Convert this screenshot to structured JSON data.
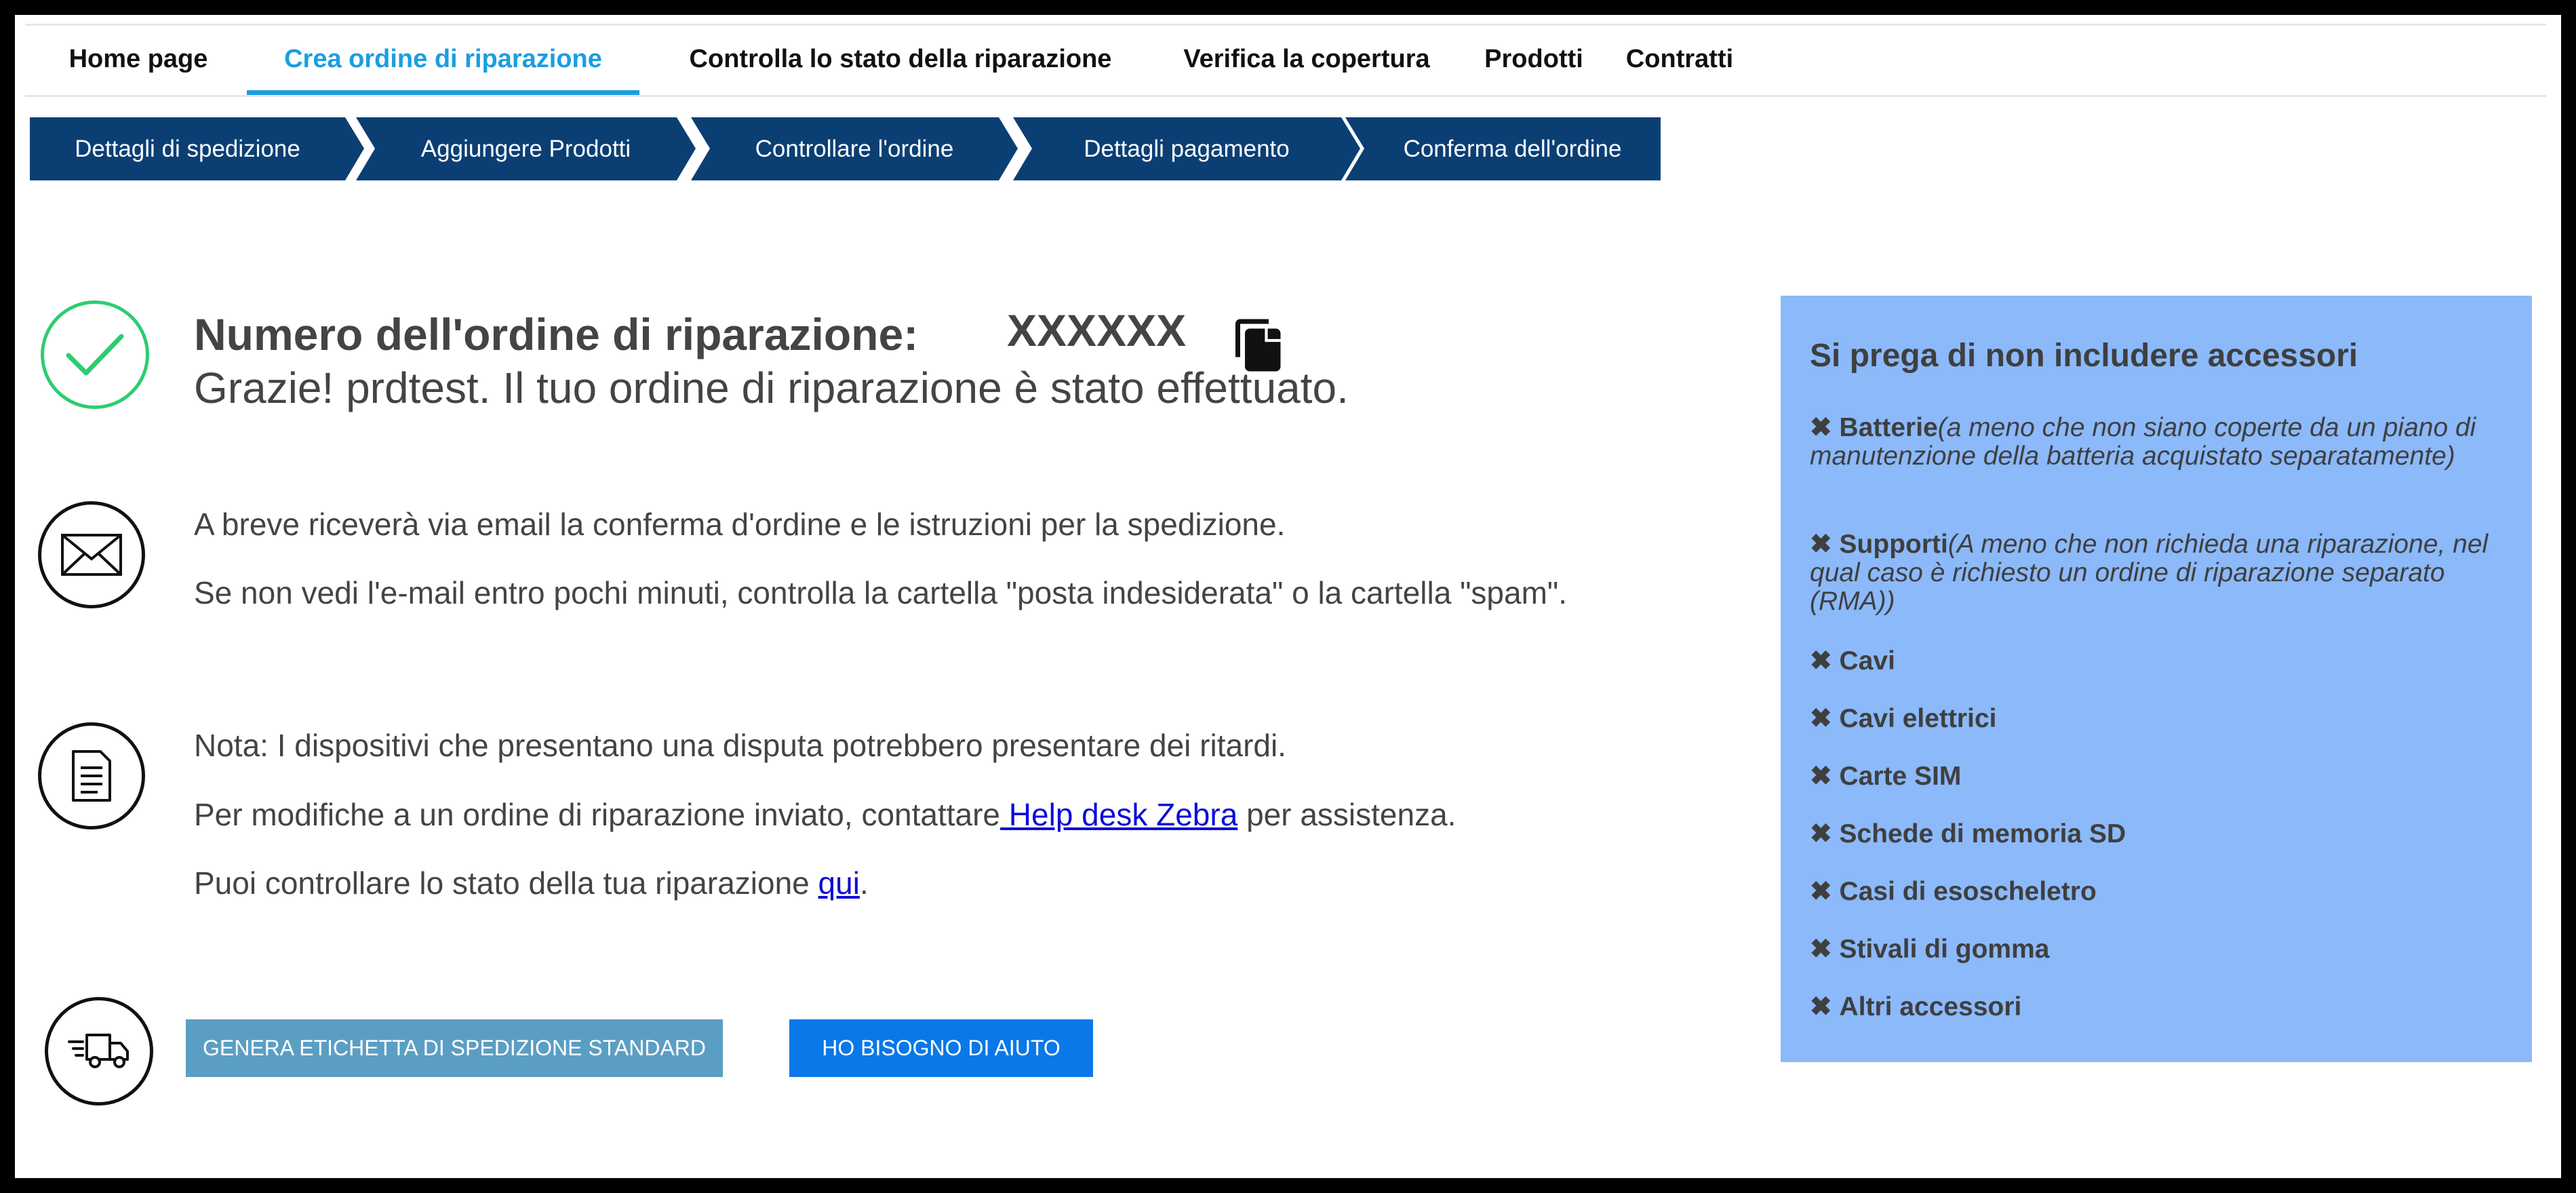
{
  "nav": {
    "tabs": [
      {
        "label": "Home page"
      },
      {
        "label": "Crea ordine di riparazione"
      },
      {
        "label": "Controlla lo stato della riparazione"
      },
      {
        "label": "Verifica la copertura"
      },
      {
        "label": "Prodotti"
      },
      {
        "label": "Contratti"
      }
    ],
    "active_index": 1
  },
  "steps": [
    {
      "label": "Dettagli di spedizione"
    },
    {
      "label": "Aggiungere Prodotti"
    },
    {
      "label": "Controllare l'ordine"
    },
    {
      "label": "Dettagli pagamento"
    },
    {
      "label": "Conferma dell'ordine"
    }
  ],
  "confirmation": {
    "order_label": "Numero dell'ordine di riparazione:",
    "order_number": "XXXXXX",
    "thanks": "Grazie! prdtest. Il tuo ordine di riparazione è stato effettuato."
  },
  "email_section": {
    "line1": "A breve riceverà via email la conferma d'ordine e le istruzioni per la spedizione.",
    "line2": "Se non vedi l'e-mail entro pochi minuti, controlla la cartella \"posta indesiderata\" o la cartella \"spam\"."
  },
  "note_section": {
    "line1": "Nota: I dispositivi che presentano una disputa potrebbero presentare dei ritardi.",
    "line2_prefix": "Per modifiche a un ordine di riparazione inviato, contattare",
    "line2_link": " Help desk Zebra",
    "line2_suffix": " per assistenza.",
    "line3_prefix": "Puoi controllare lo stato della tua riparazione ",
    "line3_link": "qui",
    "line3_suffix": "."
  },
  "buttons": {
    "shipping_label": "GENERA ETICHETTA DI SPEDIZIONE STANDARD",
    "help": "HO BISOGNO DI AIUTO"
  },
  "side_panel": {
    "title": "Si prega di non includere accessori",
    "items": [
      {
        "mark": "✖",
        "name": "Batterie",
        "note": "(a meno che non siano coperte da un piano di manutenzione della batteria acquistato separatamente)"
      },
      {
        "mark": "✖",
        "name": "Supporti",
        "note": "(A meno che non richieda una riparazione, nel qual caso è richiesto un ordine di riparazione separato (RMA))"
      },
      {
        "mark": "✖",
        "name": "Cavi",
        "note": ""
      },
      {
        "mark": "✖",
        "name": "Cavi elettrici",
        "note": ""
      },
      {
        "mark": "✖",
        "name": "Carte SIM",
        "note": ""
      },
      {
        "mark": "✖",
        "name": "Schede di memoria SD",
        "note": ""
      },
      {
        "mark": "✖",
        "name": "Casi di esoscheletro",
        "note": ""
      },
      {
        "mark": "✖",
        "name": "Stivali di gomma",
        "note": ""
      },
      {
        "mark": "✖",
        "name": "Altri accessori",
        "note": ""
      }
    ]
  },
  "colors": {
    "nav_active": "#1a9ee0",
    "step_bg": "#0b3f74",
    "check_green": "#2ecc71",
    "side_bg": "#8bb9fa",
    "btn_light": "#5b9ec4",
    "btn_dark": "#0a78e8",
    "link": "#0b0bd9"
  }
}
